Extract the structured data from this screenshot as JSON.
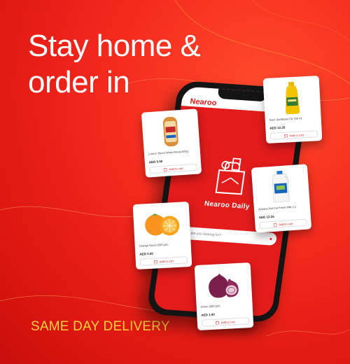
{
  "headline": {
    "line1": "Stay home &",
    "line2": "order in"
  },
  "tagline": "SAME DAY DELIVERY",
  "app": {
    "brand": "Nearoo",
    "title": "Nearoo Daily",
    "search_placeholder": "What are you looking for?",
    "accent": "#e31b1b"
  },
  "products": {
    "bread": {
      "name": "Lusine Sliced White Bread 600g",
      "price": "AED 5.50",
      "cart_label": "Add to cart"
    },
    "oil": {
      "name": "Noor Sunflower Oil 750 ml",
      "price": "AED 12.25",
      "cart_label": "Add to cart"
    },
    "milk": {
      "name": "Almarai Full Fat Fresh Milk 2 L",
      "price": "AED 12.25",
      "cart_label": "Add to cart"
    },
    "orange": {
      "name": "Orange Naval (500 gm)",
      "price": "AED 3.00",
      "cart_label": "Add to cart"
    },
    "onion": {
      "name": "Onion (500 gm)",
      "price": "AED 1.00",
      "cart_label": "Add to cart"
    }
  },
  "colors": {
    "background": "#e8201a",
    "tagline": "#ffd23a",
    "card": "#ffffff"
  }
}
